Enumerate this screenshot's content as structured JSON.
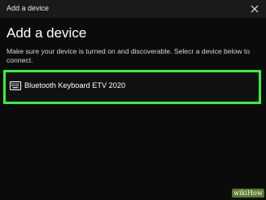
{
  "window": {
    "title": "Add a device",
    "close_icon": "close-icon"
  },
  "content": {
    "heading": "Add a device",
    "instructions": "Make sure your device is turned on and discoverable. Selecr a device below to connect."
  },
  "devices": [
    {
      "label": "Bluetooth Keyboard ETV 2020",
      "icon": "keyboard-icon",
      "highlight_color": "#36f03a"
    }
  ],
  "watermark": {
    "text": "wikiHow"
  },
  "colors": {
    "background": "#0b0b0b",
    "titlebar": "#1a1a1a",
    "highlight": "#36f03a"
  }
}
